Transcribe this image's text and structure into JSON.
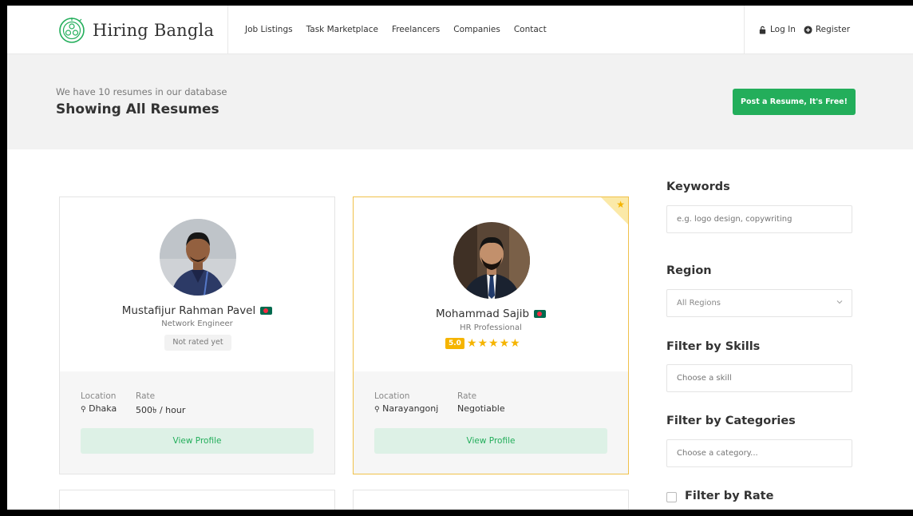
{
  "header": {
    "brand": "Hiring Bangla",
    "nav": [
      "Job Listings",
      "Task Marketplace",
      "Freelancers",
      "Companies",
      "Contact"
    ],
    "login": "Log In",
    "register": "Register"
  },
  "titlebar": {
    "count_text": "We have 10 resumes in our database",
    "heading": "Showing All Resumes",
    "post_button": "Post a Resume, It's Free!"
  },
  "cards": [
    {
      "name": "Mustafijur Rahman Pavel",
      "role": "Network Engineer",
      "rating_text": "Not rated yet",
      "location_label": "Location",
      "location": "Dhaka",
      "rate_label": "Rate",
      "rate": "500৳ / hour",
      "button": "View Profile",
      "featured": false
    },
    {
      "name": "Mohammad Sajib",
      "role": "HR Professional",
      "rating_score": "5.0",
      "stars": 5,
      "location_label": "Location",
      "location": "Narayangonj",
      "rate_label": "Rate",
      "rate": "Negotiable",
      "button": "View Profile",
      "featured": true
    }
  ],
  "sidebar": {
    "keywords_title": "Keywords",
    "keywords_placeholder": "e.g. logo design, copywriting",
    "region_title": "Region",
    "region_value": "All Regions",
    "skills_title": "Filter by Skills",
    "skills_placeholder": "Choose a skill",
    "categories_title": "Filter by Categories",
    "categories_placeholder": "Choose a category...",
    "rate_title": "Filter by Rate"
  },
  "colors": {
    "accent_green": "#23ae5b",
    "star_gold": "#f5b400",
    "featured_border": "#f0c14b"
  }
}
